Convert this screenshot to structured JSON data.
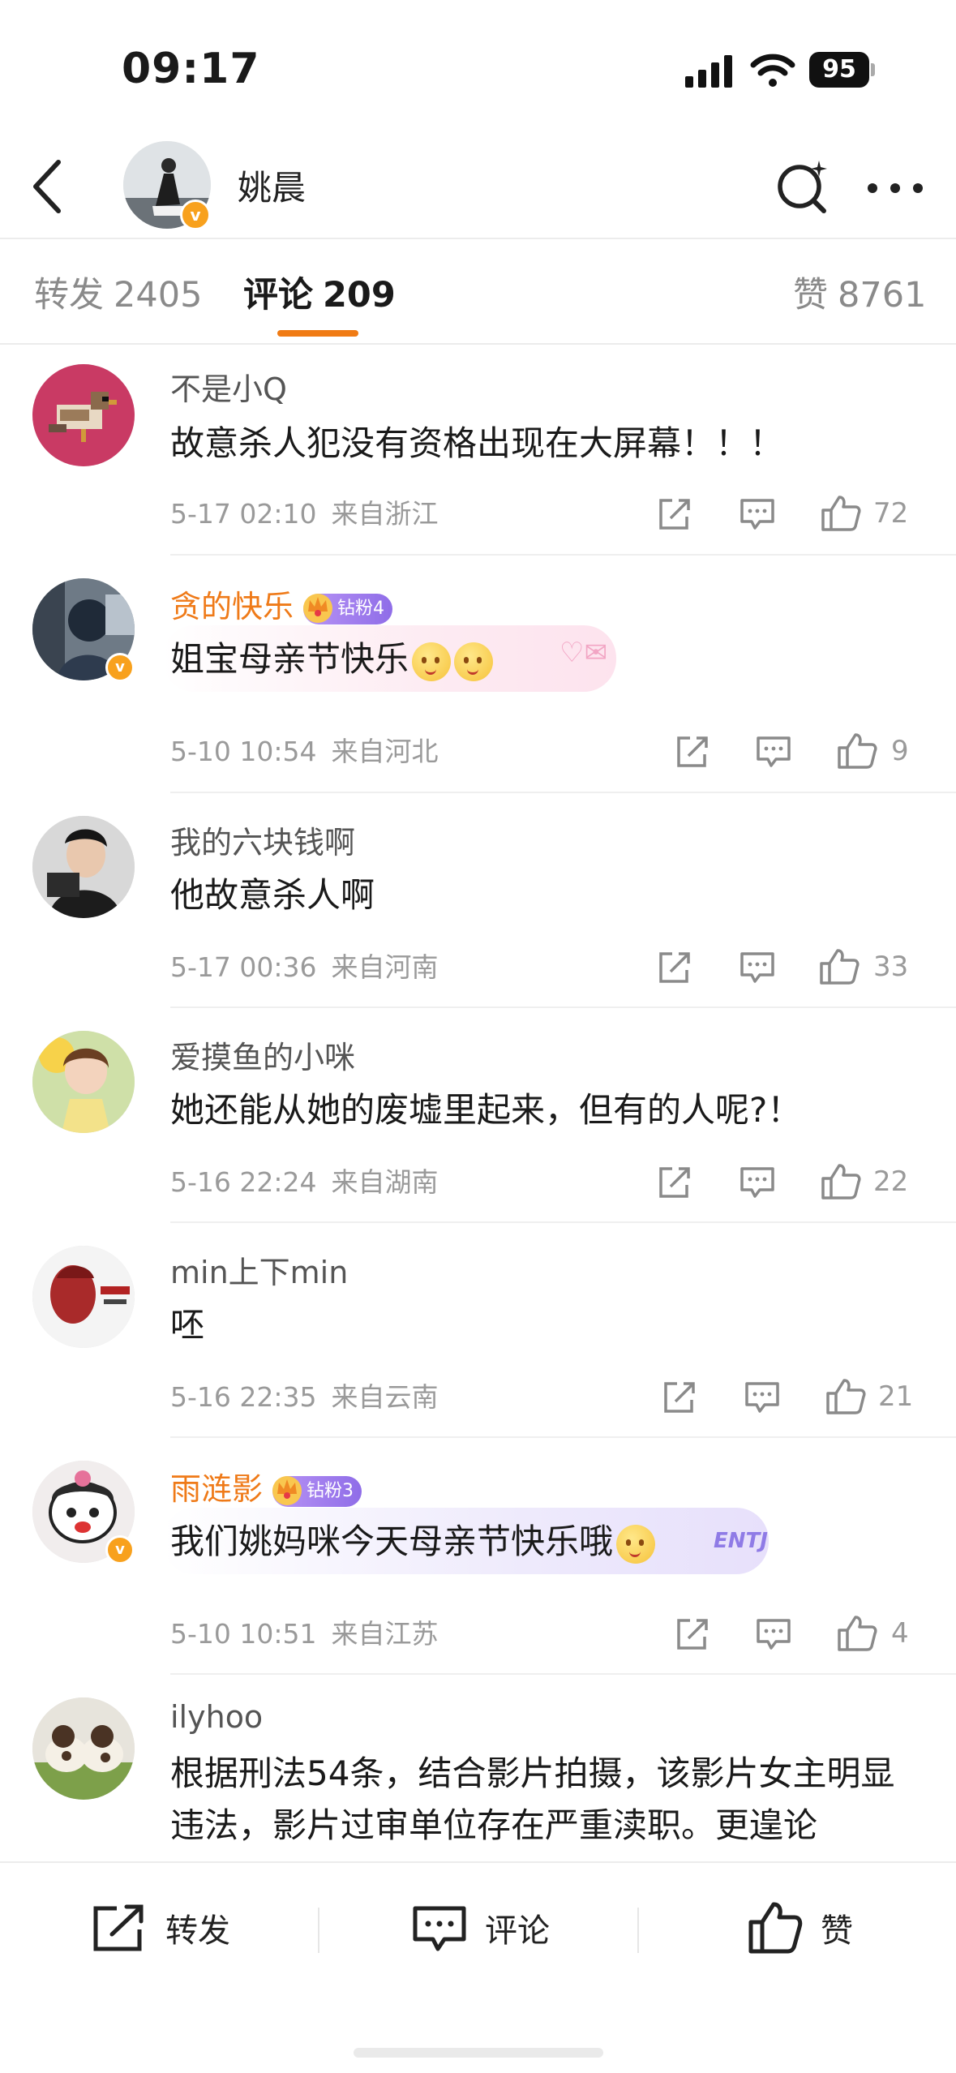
{
  "status_bar": {
    "time": "09:17",
    "battery": "95"
  },
  "header": {
    "name": "姚晨"
  },
  "tabs": {
    "repost_label": "转发",
    "repost_count": "2405",
    "comments_label": "评论",
    "comments_count": "209",
    "likes_label": "赞",
    "likes_count": "8761"
  },
  "comments": [
    {
      "name": "不是小Q",
      "text": "故意杀人犯没有资格出现在大屏幕！！！",
      "date": "5-17 02:10",
      "location": "来自浙江",
      "likes": "72"
    },
    {
      "name": "贪的快乐",
      "fan_badge": "钻粉4",
      "text": "姐宝母亲节快乐",
      "date": "5-10 10:54",
      "location": "来自河北",
      "likes": "9"
    },
    {
      "name": "我的六块钱啊",
      "text": "他故意杀人啊",
      "date": "5-17 00:36",
      "location": "来自河南",
      "likes": "33"
    },
    {
      "name": "爱摸鱼的小咪",
      "text": "她还能从她的废墟里起来，但有的人呢?！",
      "date": "5-16 22:24",
      "location": "来自湖南",
      "likes": "22"
    },
    {
      "name": "min上下min",
      "text": "呸",
      "date": "5-16 22:35",
      "location": "来自云南",
      "likes": "21"
    },
    {
      "name": "雨涟影",
      "fan_badge": "钻粉3",
      "text": "我们姚妈咪今天母亲节快乐哦",
      "date": "5-10 10:51",
      "location": "来自江苏",
      "likes": "4"
    },
    {
      "name": "ilyhoo",
      "text": "根据刑法54条，结合影片拍摄，该影片女主明显违法，影片过审单位存在严重渎职。更遑论"
    }
  ],
  "bubble_tags": {
    "entj": "ENTJ"
  },
  "bottom_bar": {
    "repost": "转发",
    "comment": "评论",
    "like": "赞"
  },
  "colors": {
    "accent": "#f07b14",
    "vip_name": "#ef7a18",
    "verified": "#f8a11d",
    "meta": "#9a9a9a"
  }
}
